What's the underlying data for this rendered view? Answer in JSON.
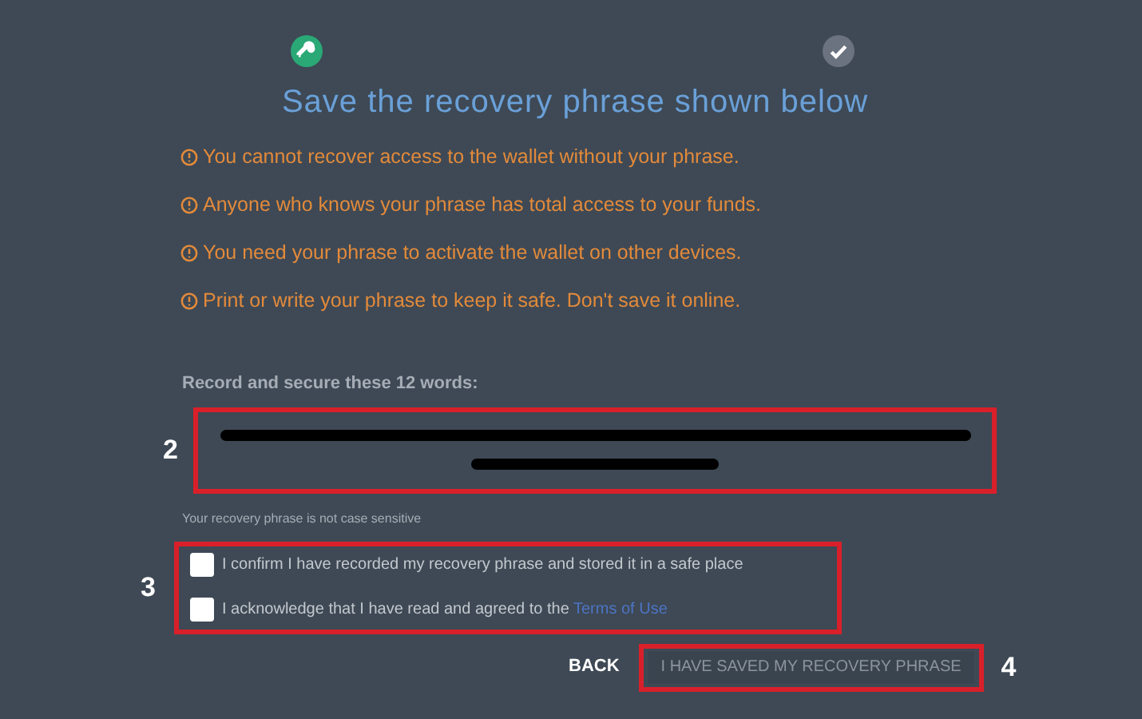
{
  "steps": [
    {
      "kind": "key",
      "done": true
    },
    {
      "kind": "check",
      "done": false
    }
  ],
  "title": "Save the recovery phrase shown below",
  "warnings": [
    "You cannot recover access to the wallet without your phrase.",
    "Anyone who knows your phrase has total access to your funds.",
    "You need your phrase to activate the wallet on other devices.",
    "Print or write your phrase to keep it safe. Don't save it online."
  ],
  "phrase_label": "Record and secure these 12 words:",
  "phrase_callout": "2",
  "phrase_note": "Your recovery phrase is not case sensitive",
  "checks_callout": "3",
  "checks": [
    {
      "text": "I confirm I have recorded my recovery phrase and stored it in a safe place",
      "checked": false
    },
    {
      "text": "I acknowledge that I have read and agreed to the ",
      "link": "Terms of Use",
      "checked": false
    }
  ],
  "back": "BACK",
  "save_button": {
    "label": "I HAVE SAVED MY RECOVERY PHRASE",
    "disabled": true
  },
  "save_callout": "4"
}
